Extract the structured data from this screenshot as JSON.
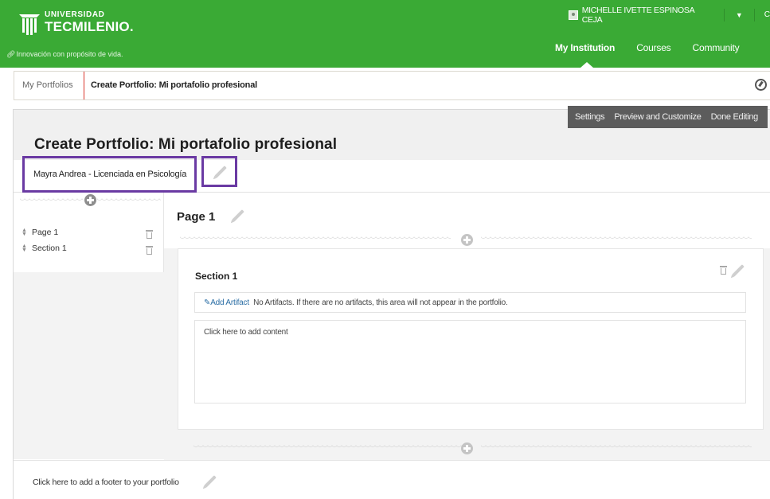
{
  "brand": {
    "universidad": "UNIVERSIDAD",
    "name": "TECMILENIO.",
    "tagline": "Innovación con propósito de vida."
  },
  "user": {
    "name": "MICHELLE IVETTE ESPINOSA CEJA",
    "extra": "C"
  },
  "nav": {
    "items": [
      {
        "label": "My Institution",
        "active": true
      },
      {
        "label": "Courses",
        "active": false
      },
      {
        "label": "Community",
        "active": false
      }
    ]
  },
  "breadcrumb": {
    "home": "My Portfolios",
    "current": "Create Portfolio: Mi portafolio profesional"
  },
  "editbar": {
    "settings": "Settings",
    "preview": "Preview and Customize",
    "done": "Done Editing"
  },
  "portfolio": {
    "title": "Create Portfolio: Mi portafolio profesional",
    "subtitle": "Mayra Andrea - Licenciada en Psicología"
  },
  "tree": {
    "items": [
      {
        "label": "Page 1"
      },
      {
        "label": "Section 1"
      }
    ]
  },
  "page": {
    "heading": "Page 1"
  },
  "section": {
    "title": "Section 1",
    "add_artifact": "Add Artifact",
    "no_artifacts": "No Artifacts. If there are no artifacts, this area will not appear in the portfolio.",
    "content_placeholder": "Click here to add content"
  },
  "footer": {
    "text": "Click here to add a footer to your portfolio"
  },
  "colors": {
    "header_green": "#3aaa35",
    "highlight_purple": "#6a3aa3",
    "breadcrumb_divider": "#d9362b",
    "link_blue": "#2b6ea5",
    "edit_bar": "#5c5c5c"
  }
}
